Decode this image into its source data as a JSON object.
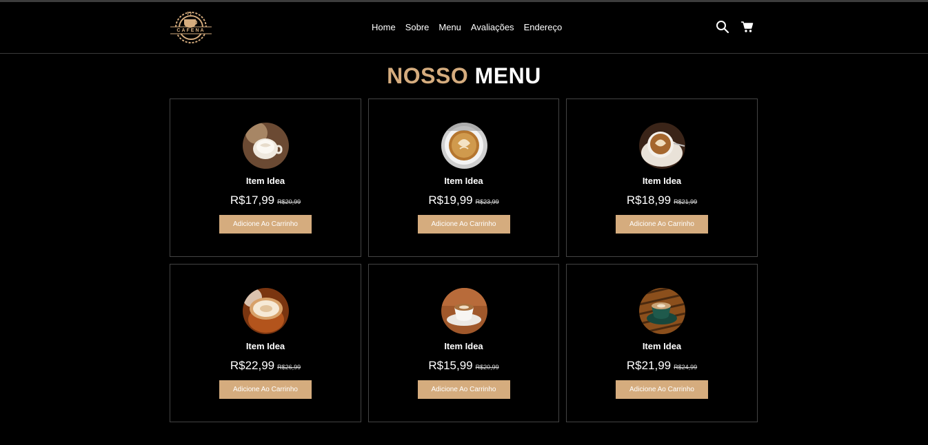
{
  "brand": {
    "logo_text": "CAFENA",
    "accent_color": "#d5ac7e"
  },
  "nav": {
    "links": [
      "Home",
      "Sobre",
      "Menu",
      "Avaliações",
      "Endereço"
    ],
    "icons": [
      "search-icon",
      "cart-icon"
    ]
  },
  "menu": {
    "title_accent": "NOSSO",
    "title_plain": "MENU",
    "items": [
      {
        "name": "Item Idea",
        "price": "R$17,99",
        "old_price": "R$20,99",
        "button": "Adicione Ao Carrinho",
        "image": "latte-white-cup"
      },
      {
        "name": "Item Idea",
        "price": "R$19,99",
        "old_price": "R$23,99",
        "button": "Adicione Ao Carrinho",
        "image": "latte-art-cup"
      },
      {
        "name": "Item Idea",
        "price": "R$18,99",
        "old_price": "R$21,99",
        "button": "Adicione Ao Carrinho",
        "image": "latte-art-spoon"
      },
      {
        "name": "Item Idea",
        "price": "R$22,99",
        "old_price": "R$26,99",
        "button": "Adicione Ao Carrinho",
        "image": "cappuccino-glass"
      },
      {
        "name": "Item Idea",
        "price": "R$15,99",
        "old_price": "R$20,99",
        "button": "Adicione Ao Carrinho",
        "image": "coffee-saucer-table"
      },
      {
        "name": "Item Idea",
        "price": "R$21,99",
        "old_price": "R$24,99",
        "button": "Adicione Ao Carrinho",
        "image": "green-cup-wood"
      }
    ]
  }
}
